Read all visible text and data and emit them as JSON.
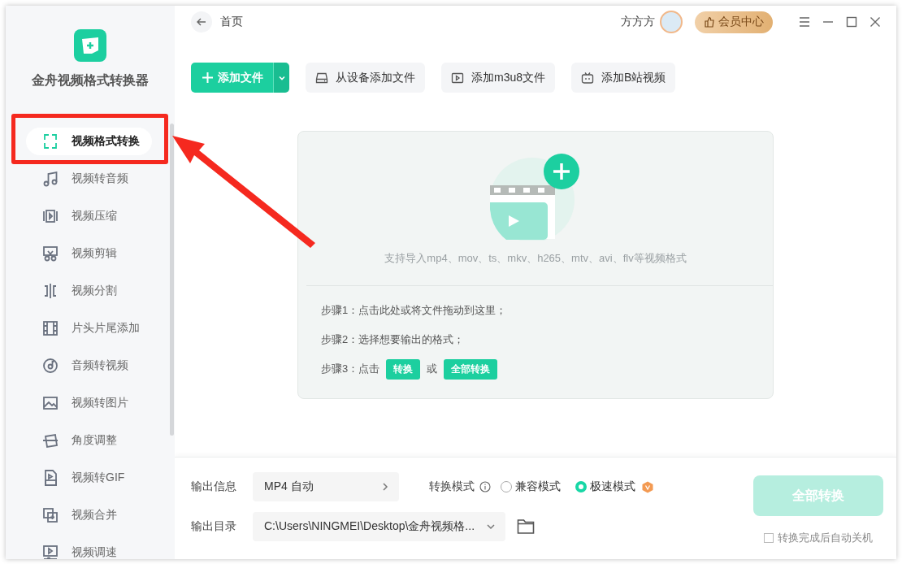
{
  "app": {
    "name": "金舟视频格式转换器"
  },
  "sidebar": {
    "items": [
      {
        "label": "视频格式转换",
        "kind": "convert",
        "selected": true
      },
      {
        "label": "视频转音频",
        "kind": "audio",
        "selected": false
      },
      {
        "label": "视频压缩",
        "kind": "compress",
        "selected": false
      },
      {
        "label": "视频剪辑",
        "kind": "cut",
        "selected": false
      },
      {
        "label": "视频分割",
        "kind": "split",
        "selected": false
      },
      {
        "label": "片头片尾添加",
        "kind": "film",
        "selected": false
      },
      {
        "label": "音频转视频",
        "kind": "disc",
        "selected": false
      },
      {
        "label": "视频转图片",
        "kind": "image",
        "selected": false
      },
      {
        "label": "角度调整",
        "kind": "rotate",
        "selected": false
      },
      {
        "label": "视频转GIF",
        "kind": "gif",
        "selected": false
      },
      {
        "label": "视频合并",
        "kind": "merge",
        "selected": false
      },
      {
        "label": "视频调速",
        "kind": "speed",
        "selected": false
      }
    ]
  },
  "topbar": {
    "back_label": "首页",
    "username": "方方方",
    "vip_button": "会员中心"
  },
  "toolbar": {
    "buttons": [
      {
        "label": "添加文件",
        "kind": "primary"
      },
      {
        "label": "从设备添加文件",
        "kind": "device"
      },
      {
        "label": "添加m3u8文件",
        "kind": "m3u8"
      },
      {
        "label": "添加B站视频",
        "kind": "bilibili"
      }
    ]
  },
  "dropzone": {
    "hint": "支持导入mp4、mov、ts、mkv、h265、mtv、avi、flv等视频格式",
    "steps": [
      {
        "segments": [
          {
            "kind": "text",
            "text": "步骤1：点击此处或将文件拖动到这里；"
          }
        ]
      },
      {
        "segments": [
          {
            "kind": "text",
            "text": "步骤2：选择想要输出的格式；"
          }
        ]
      },
      {
        "segments": [
          {
            "kind": "text",
            "text": "步骤3：点击"
          },
          {
            "kind": "chip",
            "text": "转换"
          },
          {
            "kind": "text",
            "text": "或"
          },
          {
            "kind": "chip",
            "text": "全部转换"
          }
        ]
      }
    ]
  },
  "output": {
    "info_label": "输出信息",
    "info_value": "MP4 自动",
    "mode_label": "转换模式",
    "modes": [
      {
        "label": "兼容模式",
        "selected": false
      },
      {
        "label": "极速模式",
        "selected": true
      }
    ],
    "dir_label": "输出目录",
    "dir_value": "C:\\Users\\NINGMEI\\Desktop\\金舟视频格...",
    "convert_all": {
      "label": "全部转换",
      "disabled": true
    },
    "auto_shutdown": {
      "label": "转换完成后自动关机",
      "checked": false
    }
  }
}
